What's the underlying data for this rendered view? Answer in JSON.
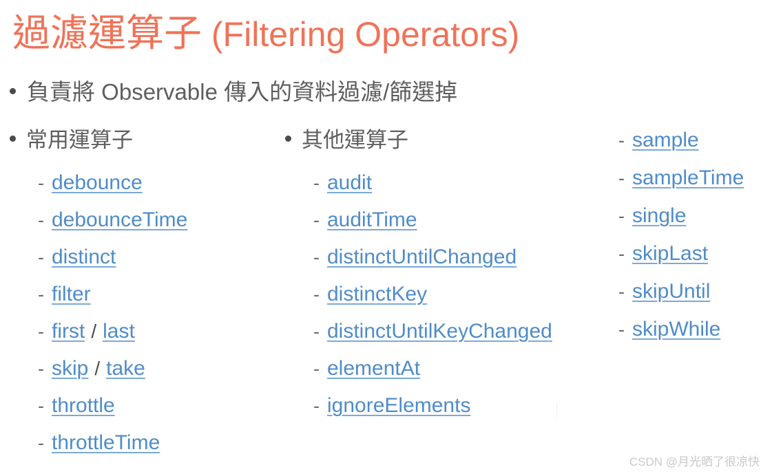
{
  "slide": {
    "title_cjk": "過濾運算子",
    "title_en": " (Filtering Operators)",
    "lead_text": "負責將 Observable 傳入的資料過濾/篩選掉"
  },
  "columns": [
    {
      "heading": "常用運算子",
      "items": [
        {
          "parts": [
            {
              "text": "debounce",
              "link": true
            }
          ]
        },
        {
          "parts": [
            {
              "text": "debounceTime",
              "link": true
            }
          ]
        },
        {
          "parts": [
            {
              "text": "distinct",
              "link": true
            }
          ]
        },
        {
          "parts": [
            {
              "text": "filter",
              "link": true
            }
          ]
        },
        {
          "parts": [
            {
              "text": "first",
              "link": true
            },
            {
              "text": "/",
              "link": false
            },
            {
              "text": "last",
              "link": true
            }
          ]
        },
        {
          "parts": [
            {
              "text": "skip",
              "link": true
            },
            {
              "text": "/",
              "link": false
            },
            {
              "text": "take",
              "link": true
            }
          ]
        },
        {
          "parts": [
            {
              "text": "throttle",
              "link": true
            }
          ]
        },
        {
          "parts": [
            {
              "text": "throttleTime",
              "link": true
            }
          ]
        }
      ]
    },
    {
      "heading": "其他運算子",
      "items": [
        {
          "parts": [
            {
              "text": "audit",
              "link": true
            }
          ]
        },
        {
          "parts": [
            {
              "text": "auditTime",
              "link": true
            }
          ]
        },
        {
          "parts": [
            {
              "text": "distinctUntilChanged",
              "link": true
            }
          ]
        },
        {
          "parts": [
            {
              "text": "distinctKey",
              "link": true
            }
          ]
        },
        {
          "parts": [
            {
              "text": "distinctUntilKeyChanged",
              "link": true
            }
          ]
        },
        {
          "parts": [
            {
              "text": "elementAt",
              "link": true
            }
          ]
        },
        {
          "parts": [
            {
              "text": "ignoreElements",
              "link": true
            }
          ]
        }
      ]
    },
    {
      "heading": "",
      "items": [
        {
          "parts": [
            {
              "text": "sample",
              "link": true
            }
          ]
        },
        {
          "parts": [
            {
              "text": "sampleTime",
              "link": true
            }
          ]
        },
        {
          "parts": [
            {
              "text": "single",
              "link": true
            }
          ]
        },
        {
          "parts": [
            {
              "text": "skipLast",
              "link": true
            }
          ]
        },
        {
          "parts": [
            {
              "text": "skipUntil",
              "link": true
            }
          ]
        },
        {
          "parts": [
            {
              "text": "skipWhile",
              "link": true
            }
          ]
        }
      ]
    }
  ],
  "bullet_marker": "•",
  "dash_marker": "-",
  "watermark": "CSDN @月光晒了很凉快",
  "colors": {
    "title": "#ef7358",
    "body_text": "#5e5e5e",
    "link": "#4f8cc9",
    "link_underline": "#7aa9d6",
    "dash": "#6b6b6b",
    "watermark": "#c9c9c9",
    "background": "#ffffff"
  }
}
